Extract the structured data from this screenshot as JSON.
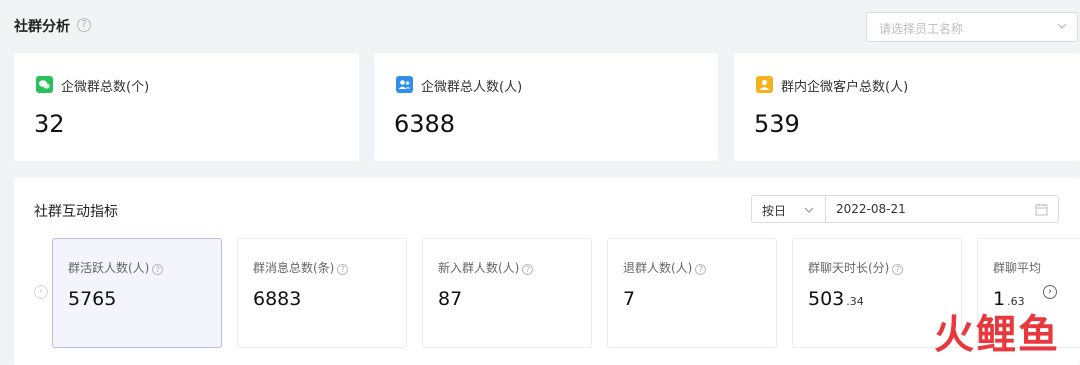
{
  "header": {
    "title": "社群分析",
    "help_glyph": "?",
    "employee_select": {
      "placeholder": "请选择员工名称"
    }
  },
  "stats": [
    {
      "label": "企微群总数(个)",
      "value": "32",
      "icon": "wechat-group-icon",
      "color": "#2bc15a"
    },
    {
      "label": "企微群总人数(人)",
      "value": "6388",
      "icon": "group-members-icon",
      "color": "#2f8fe8"
    },
    {
      "label": "群内企微客户总数(人)",
      "value": "539",
      "icon": "customer-icon",
      "color": "#f5b21c"
    }
  ],
  "interaction": {
    "title": "社群互动指标",
    "granularity": "按日",
    "date": "2022-08-21",
    "prev_glyph": "‹",
    "next_glyph": "›",
    "metrics": [
      {
        "label": "群活跃人数(人)",
        "value": "5765",
        "decimal": "",
        "active": true
      },
      {
        "label": "群消息总数(条)",
        "value": "6883",
        "decimal": ""
      },
      {
        "label": "新入群人数(人)",
        "value": "87",
        "decimal": ""
      },
      {
        "label": "退群人数(人)",
        "value": "7",
        "decimal": ""
      },
      {
        "label": "群聊天时长(分)",
        "value": "503",
        "decimal": ".34"
      },
      {
        "label": "群聊平均",
        "value": "1",
        "decimal": ".63"
      }
    ]
  },
  "watermark": "火鲤鱼"
}
